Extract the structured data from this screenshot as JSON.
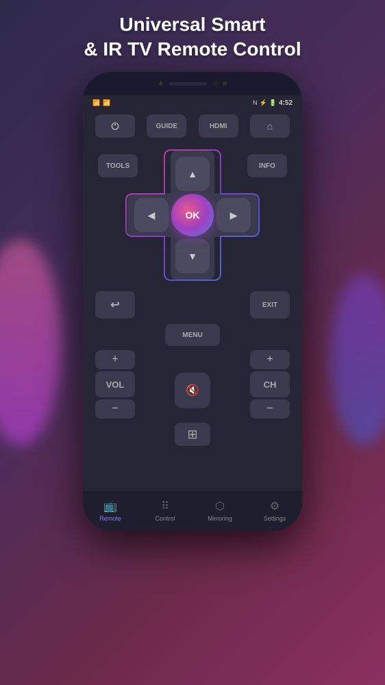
{
  "page": {
    "title_line1": "Universal Smart",
    "title_line2": "& IR TV Remote Control"
  },
  "phone": {
    "status": {
      "time": "4:52",
      "wifi_icon": "wifi",
      "battery_icon": "battery",
      "nfc_icon": "N",
      "bluetooth_icon": "bluetooth"
    }
  },
  "remote": {
    "top_buttons": [
      {
        "id": "power",
        "label": "⏻",
        "type": "icon"
      },
      {
        "id": "guide",
        "label": "GUIDE",
        "type": "text"
      },
      {
        "id": "hdmi",
        "label": "HDMI",
        "type": "text"
      },
      {
        "id": "home",
        "label": "⌂",
        "type": "icon"
      }
    ],
    "tools_label": "TOOLS",
    "info_label": "INFO",
    "ok_label": "OK",
    "back_label": "↩",
    "exit_label": "EXIT",
    "menu_label": "MENU",
    "vol_plus": "+",
    "vol_label": "VOL",
    "vol_minus": "−",
    "mute_icon": "🔇",
    "ch_plus": "+",
    "ch_label": "CH",
    "ch_minus": "−",
    "source_icon": "⊕"
  },
  "nav": {
    "items": [
      {
        "id": "remote",
        "label": "Remote",
        "icon": "📺",
        "active": true
      },
      {
        "id": "control",
        "label": "Control",
        "icon": "⠿",
        "active": false
      },
      {
        "id": "mirroring",
        "label": "Mirroring",
        "icon": "⬡",
        "active": false
      },
      {
        "id": "settings",
        "label": "Settings",
        "icon": "⚙",
        "active": false
      }
    ]
  }
}
